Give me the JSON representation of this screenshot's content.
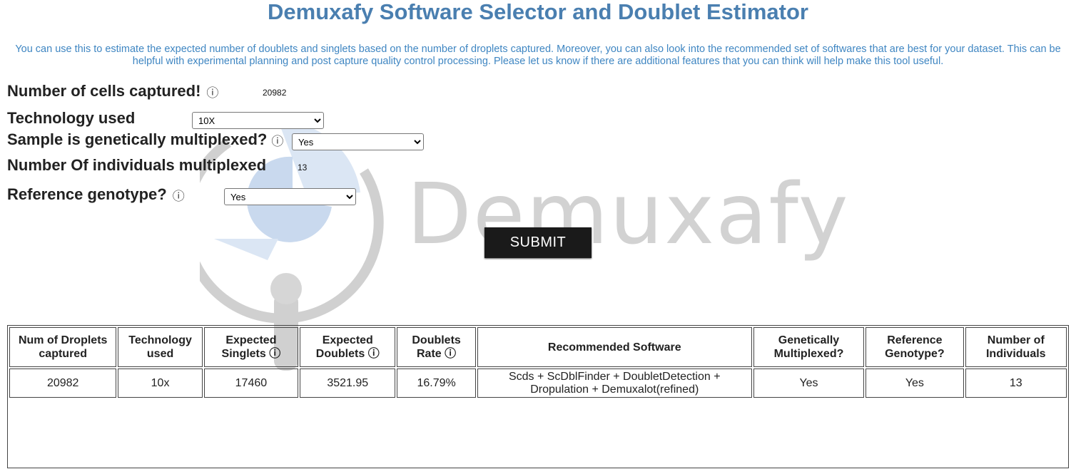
{
  "header": {
    "title": "Demuxafy Software Selector and Doublet Estimator",
    "intro": "You can use this to estimate the expected number of doublets and singlets based on the number of droplets captured. Moreover, you can also look into the recommended set of softwares that are best for your dataset. This can be helpful with experimental planning and post capture quality control processing. Please let us know if there are additional features that you can think will help make this tool useful."
  },
  "watermark": {
    "text": "Demuxafy"
  },
  "form": {
    "cells_label": "Number of cells captured!",
    "cells_value": "20982",
    "tech_label": "Technology used",
    "tech_value": "10X",
    "multiplexed_label": "Sample is genetically multiplexed?",
    "multiplexed_value": "Yes",
    "individuals_label": "Number Of individuals multiplexed",
    "individuals_value": "13",
    "reference_label": "Reference genotype?",
    "reference_value": "Yes",
    "info_glyph": "ⓘ",
    "submit_label": "SUBMIT"
  },
  "table": {
    "headers": {
      "droplets": "Num of Droplets captured",
      "technology": "Technology used",
      "singlets": "Expected Singlets",
      "doublets": "Expected Doublets",
      "rate": "Doublets Rate",
      "software": "Recommended Software",
      "multiplexed": "Genetically Multiplexed?",
      "reference": "Reference Genotype?",
      "individuals": "Number of Individuals"
    },
    "row": {
      "droplets": "20982",
      "technology": "10x",
      "singlets": "17460",
      "doublets": "3521.95",
      "rate": "16.79%",
      "software": "Scds + ScDblFinder + DoubletDetection + Dropulation + Demuxalot(refined)",
      "multiplexed": "Yes",
      "reference": "Yes",
      "individuals": "13"
    }
  },
  "colors": {
    "title": "#4a7fb0",
    "intro": "#3f86c2",
    "button": "#1a1a1a"
  }
}
